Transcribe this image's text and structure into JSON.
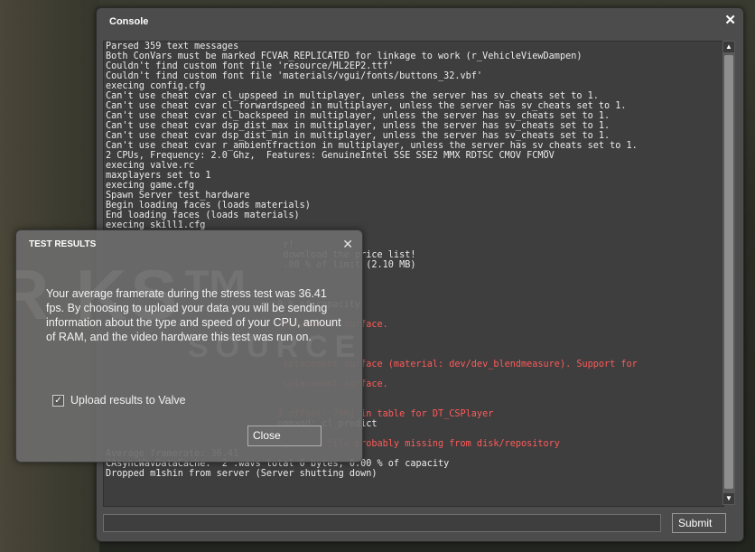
{
  "console": {
    "title": "Console",
    "close_glyph": "✕",
    "lines": [
      {
        "text": "Parsed 359 text messages",
        "red": false
      },
      {
        "text": "Both ConVars must be marked FCVAR_REPLICATED for linkage to work (r_VehicleViewDampen)",
        "red": false
      },
      {
        "text": "Couldn't find custom font file 'resource/HL2EP2.ttf'",
        "red": false
      },
      {
        "text": "Couldn't find custom font file 'materials/vgui/fonts/buttons_32.vbf'",
        "red": false
      },
      {
        "text": "execing config.cfg",
        "red": false
      },
      {
        "text": "Can't use cheat cvar cl_upspeed in multiplayer, unless the server has sv_cheats set to 1.",
        "red": false
      },
      {
        "text": "Can't use cheat cvar cl_forwardspeed in multiplayer, unless the server has sv_cheats set to 1.",
        "red": false
      },
      {
        "text": "Can't use cheat cvar cl_backspeed in multiplayer, unless the server has sv_cheats set to 1.",
        "red": false
      },
      {
        "text": "Can't use cheat cvar dsp_dist_max in multiplayer, unless the server has sv_cheats set to 1.",
        "red": false
      },
      {
        "text": "Can't use cheat cvar dsp_dist_min in multiplayer, unless the server has sv_cheats set to 1.",
        "red": false
      },
      {
        "text": "Can't use cheat cvar r_ambientfraction in multiplayer, unless the server has sv_cheats set to 1.",
        "red": false
      },
      {
        "text": "2 CPUs, Frequency: 2.0 Ghz,  Features: GenuineIntel SSE SSE2 MMX RDTSC CMOV FCMOV",
        "red": false
      },
      {
        "text": "execing valve.rc",
        "red": false
      },
      {
        "text": "maxplayers set to 1",
        "red": false
      },
      {
        "text": "execing game.cfg",
        "red": false
      },
      {
        "text": "Spawn Server test_hardware",
        "red": false
      },
      {
        "text": "Begin loading faces (loads materials)",
        "red": false
      },
      {
        "text": "End loading faces (loads materials)",
        "red": false
      },
      {
        "text": "execing skill1.cfg",
        "red": false
      },
      {
        "text": "",
        "red": false
      },
      {
        "text": "                                r!",
        "red": false
      },
      {
        "text": "                                download the price list!",
        "red": false
      },
      {
        "text": "                                .00 % of limit (2.10 MB)",
        "red": false
      },
      {
        "text": "",
        "red": false
      },
      {
        "text": "",
        "red": false
      },
      {
        "text": "",
        "red": false
      },
      {
        "text": "                               0 % of capacity",
        "red": false
      },
      {
        "text": "",
        "red": false
      },
      {
        "text": "                                splacement surface.",
        "red": true
      },
      {
        "text": "",
        "red": false
      },
      {
        "text": "",
        "red": false
      },
      {
        "text": "",
        "red": false
      },
      {
        "text": "                                splacement surface (material: dev/dev_blendmeasure). Support for",
        "red": true
      },
      {
        "text": "",
        "red": false
      },
      {
        "text": "                                splacement surface.",
        "red": true
      },
      {
        "text": "",
        "red": false
      },
      {
        "text": "",
        "red": false
      },
      {
        "text": "                               9 offset: 796] in table for DT_CSPlayer",
        "red": true
      },
      {
        "text": "                               ommand: cl_predict",
        "red": false
      },
      {
        "text": "",
        "red": false
      },
      {
        "text": "                               ig.wav\", file probably missing from disk/repository",
        "red": true
      },
      {
        "text": "Average framerate: 36.41",
        "red": false
      },
      {
        "text": "CAsyncWavDataCache:  2 .wavs total 0 bytes, 0.00 % of capacity",
        "red": false
      },
      {
        "text": "Dropped m1shin from server (Server shutting down)",
        "red": false
      }
    ],
    "scroll_up_glyph": "▲",
    "scroll_down_glyph": "▼",
    "input_value": "",
    "submit_label": "Submit"
  },
  "dialog": {
    "title": "TEST RESULTS",
    "close_glyph": "✕",
    "message": "Your average framerate during the stress test was 36.41 fps. By choosing to upload your data you will be sending information about the type and speed of your CPU, amount of RAM, and the video hardware this test was run on.",
    "watermark": "R  KS™",
    "watermark_sub": "SOURCE",
    "checkbox_checked": "✓",
    "checkbox_label": "Upload results to Valve",
    "close_label": "Close"
  }
}
